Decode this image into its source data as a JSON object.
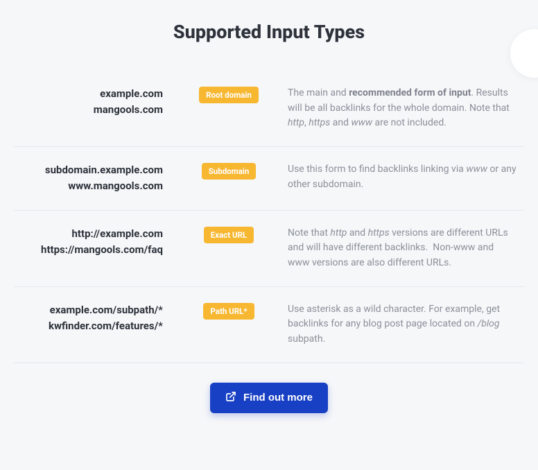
{
  "title": "Supported Input Types",
  "rows": [
    {
      "example1": "example.com",
      "example2": "mangools.com",
      "badge": "Root domain",
      "desc_html": "The main and <strong>recommended form of input</strong>. Results will be all backlinks for the whole domain. Note that <em>http</em>, <em>https</em> and <em>www</em> are not included."
    },
    {
      "example1": "subdomain.example.com",
      "example2": "www.mangools.com",
      "badge": "Subdomain",
      "desc_html": "Use this form to find backlinks linking via <em>www</em> or any other subdomain."
    },
    {
      "example1": "http://example.com",
      "example2": "https://mangools.com/faq",
      "badge": "Exact URL",
      "desc_html": "Note that <em>http</em> and <em>https</em> versions are different URLs and will have different backlinks.&nbsp; Non-www and www versions are also different URLs."
    },
    {
      "example1": "example.com/subpath/*",
      "example2": "kwfinder.com/features/*",
      "badge": "Path URL*",
      "desc_html": "Use asterisk as a wild character. For example, get backlinks for any blog post page located on <em>/blog</em> subpath."
    }
  ],
  "button_label": "Find out more"
}
